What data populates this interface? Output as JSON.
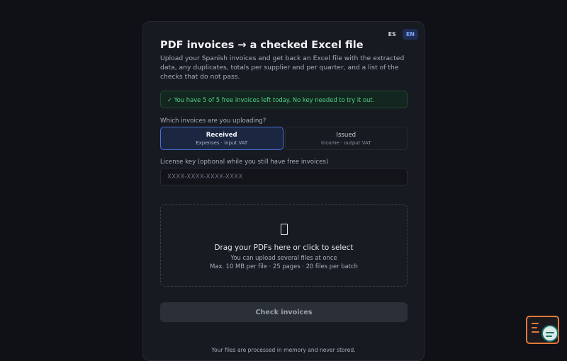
{
  "lang": {
    "es": "ES",
    "en": "EN"
  },
  "title": "PDF invoices → a checked Excel file",
  "subtitle": "Upload your Spanish invoices and get back an Excel file with the extracted data, any duplicates, totals per supplier and per quarter, and a list of the checks that do not pass.",
  "notice": "✓ You have 5 of 5 free invoices left today. No key needed to try it out.",
  "invoice_type": {
    "label": "Which invoices are you uploading?",
    "options": [
      {
        "title": "Received",
        "sub": "Expenses · input VAT"
      },
      {
        "title": "Issued",
        "sub": "Income · output VAT"
      }
    ]
  },
  "license": {
    "label": "License key (optional while you still have free invoices)",
    "placeholder": "XXXX-XXXX-XXXX-XXXX"
  },
  "dropzone": {
    "main": "Drag your PDFs here or click to select",
    "sub": "You can upload several files at once",
    "limits": "Max. 10 MB per file · 25 pages · 20 files per batch"
  },
  "submit_label": "Check invoices",
  "footer": "Your files are processed in memory and never stored.",
  "colors": {
    "accent": "#4a6fd6",
    "success": "#4fd18b",
    "widget": "#e07a3a"
  },
  "icons": {
    "dropzone": "document-icon",
    "widget": "inspector-icon"
  }
}
